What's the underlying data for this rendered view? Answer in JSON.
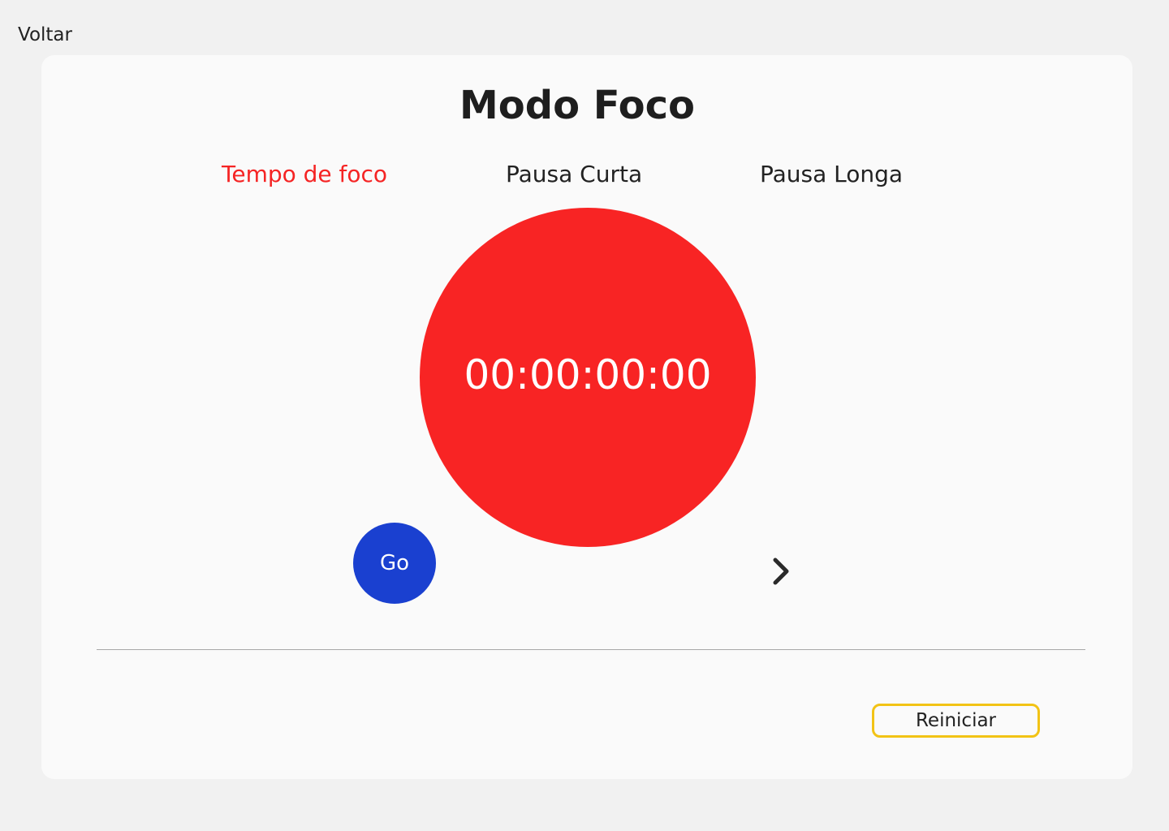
{
  "nav": {
    "back_label": "Voltar"
  },
  "main": {
    "title": "Modo Foco",
    "tabs": [
      {
        "label": "Tempo de foco",
        "active": true
      },
      {
        "label": "Pausa Curta",
        "active": false
      },
      {
        "label": "Pausa Longa",
        "active": false
      }
    ],
    "timer": "00:00:00:00",
    "go_label": "Go",
    "next_icon": "chevron-right-icon",
    "reset_label": "Reiniciar"
  },
  "colors": {
    "accent_red": "#f82424",
    "active_tab": "#f52424",
    "go_blue": "#1a40d0",
    "reset_border": "#f2c315",
    "background": "#f1f1f1",
    "card": "#fafafa"
  }
}
